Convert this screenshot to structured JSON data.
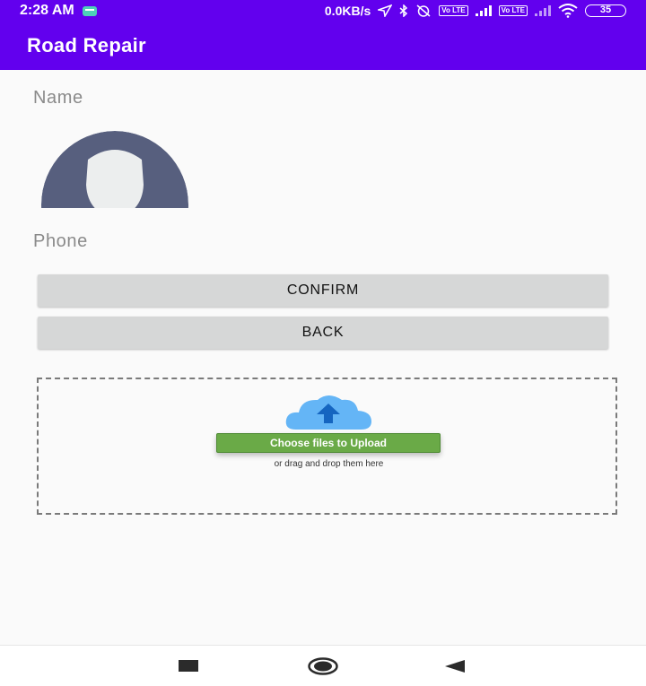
{
  "status_bar": {
    "time": "2:28 AM",
    "network_speed": "0.0KB/s",
    "lte_1": "Vo LTE",
    "lte_2": "Vo LTE",
    "battery": "35"
  },
  "app_bar": {
    "title": "Road Repair"
  },
  "form": {
    "name_label": "Name",
    "phone_label": "Phone",
    "confirm_label": "CONFIRM",
    "back_label": "BACK"
  },
  "upload": {
    "choose_label": "Choose files to Upload",
    "drag_text": "or drag and drop them here"
  },
  "nav": {
    "icons": [
      "recent-apps-icon",
      "home-icon",
      "back-icon"
    ]
  },
  "colors": {
    "primary": "#6200ee",
    "button_gray": "#d6d7d7",
    "upload_green": "#6aaa47",
    "cloud_blue": "#64b5f6",
    "avatar_bg": "#575f7e"
  }
}
